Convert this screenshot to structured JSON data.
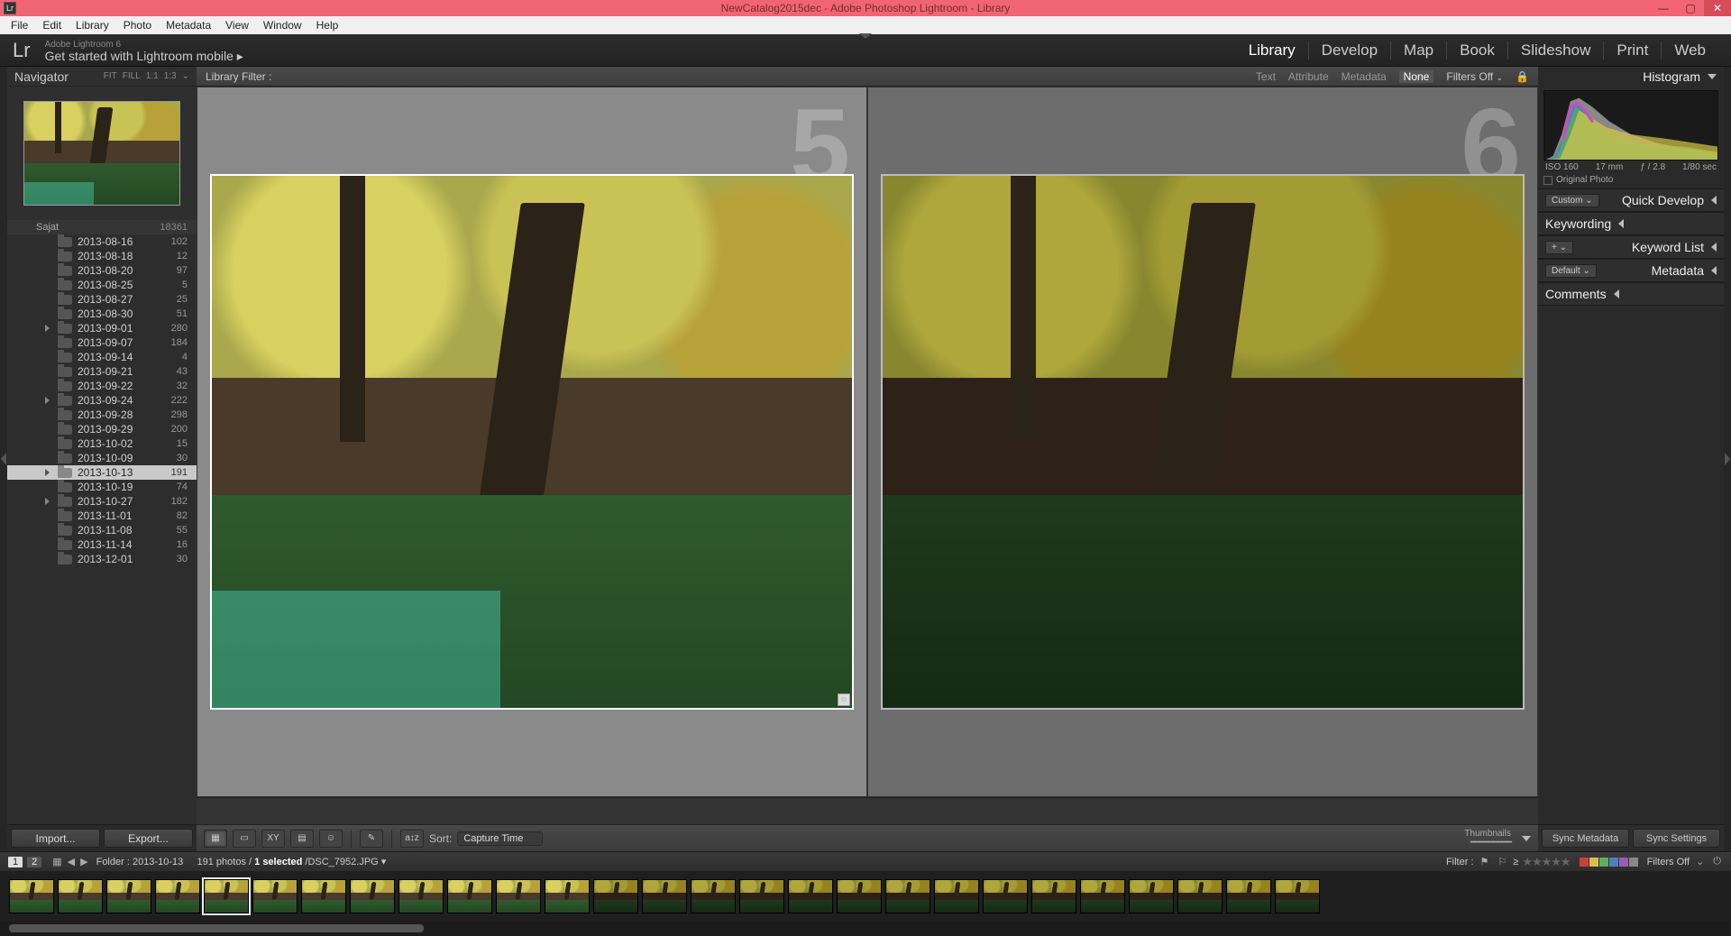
{
  "window": {
    "title": "NewCatalog2015dec - Adobe Photoshop Lightroom - Library",
    "min": "—",
    "max": "▢",
    "close": "✕"
  },
  "menu": [
    "File",
    "Edit",
    "Library",
    "Photo",
    "Metadata",
    "View",
    "Window",
    "Help"
  ],
  "header": {
    "logo": "Lr",
    "tag1": "Adobe Lightroom 6",
    "tag2": "Get started with Lightroom mobile  ▸",
    "modules": [
      "Library",
      "Develop",
      "Map",
      "Book",
      "Slideshow",
      "Print",
      "Web"
    ],
    "active_module": "Library"
  },
  "navigator": {
    "title": "Navigator",
    "opts": [
      "FIT",
      "FILL",
      "1:1",
      "1:3"
    ],
    "arrow": "⌄"
  },
  "folder_root": {
    "name": "Sajat",
    "count": "18361"
  },
  "folders": [
    {
      "name": "2013-08-16",
      "count": "102",
      "tri": false
    },
    {
      "name": "2013-08-18",
      "count": "12",
      "tri": false
    },
    {
      "name": "2013-08-20",
      "count": "97",
      "tri": false
    },
    {
      "name": "2013-08-25",
      "count": "5",
      "tri": false
    },
    {
      "name": "2013-08-27",
      "count": "25",
      "tri": false
    },
    {
      "name": "2013-08-30",
      "count": "51",
      "tri": false
    },
    {
      "name": "2013-09-01",
      "count": "280",
      "tri": true
    },
    {
      "name": "2013-09-07",
      "count": "184",
      "tri": false
    },
    {
      "name": "2013-09-14",
      "count": "4",
      "tri": false
    },
    {
      "name": "2013-09-21",
      "count": "43",
      "tri": false
    },
    {
      "name": "2013-09-22",
      "count": "32",
      "tri": false
    },
    {
      "name": "2013-09-24",
      "count": "222",
      "tri": true
    },
    {
      "name": "2013-09-28",
      "count": "298",
      "tri": false
    },
    {
      "name": "2013-09-29",
      "count": "200",
      "tri": false
    },
    {
      "name": "2013-10-02",
      "count": "15",
      "tri": false
    },
    {
      "name": "2013-10-09",
      "count": "30",
      "tri": false
    },
    {
      "name": "2013-10-13",
      "count": "191",
      "tri": true,
      "selected": true
    },
    {
      "name": "2013-10-19",
      "count": "74",
      "tri": false
    },
    {
      "name": "2013-10-27",
      "count": "182",
      "tri": true
    },
    {
      "name": "2013-11-01",
      "count": "82",
      "tri": false
    },
    {
      "name": "2013-11-08",
      "count": "55",
      "tri": false
    },
    {
      "name": "2013-11-14",
      "count": "16",
      "tri": false
    },
    {
      "name": "2013-12-01",
      "count": "30",
      "tri": false
    }
  ],
  "left_buttons": {
    "import": "Import...",
    "export": "Export..."
  },
  "library_filter": {
    "label": "Library Filter :",
    "tabs": [
      "Text",
      "Attribute",
      "Metadata",
      "None"
    ],
    "active": "None",
    "filters_off": "Filters Off",
    "lock": "🔒"
  },
  "grid": {
    "index_left": "5",
    "index_right": "6"
  },
  "toolbar": {
    "sort_label": "Sort:",
    "sort_value": "Capture Time",
    "thumbs": "Thumbnails"
  },
  "right": {
    "histogram": "Histogram",
    "iso": "ISO 160",
    "focal": "17 mm",
    "aperture": "ƒ / 2.8",
    "shutter": "1/80 sec",
    "original": "Original Photo",
    "sections": [
      {
        "ctrl": "Custom",
        "title": "Quick Develop"
      },
      {
        "ctrl": null,
        "title": "Keywording"
      },
      {
        "ctrl": "+",
        "title": "Keyword List"
      },
      {
        "ctrl": "Default",
        "title": "Metadata"
      },
      {
        "ctrl": null,
        "title": "Comments"
      }
    ],
    "sync_meta": "Sync Metadata",
    "sync_set": "Sync Settings"
  },
  "status": {
    "pages": [
      "1",
      "2"
    ],
    "folder_label": "Folder :",
    "folder": "2013-10-13",
    "count": "191 photos /",
    "selected": "1 selected",
    "file": "/DSC_7952.JPG",
    "arrow": "▾",
    "filter_label": "Filter :",
    "ge": "≥",
    "filters_off": "Filters Off"
  },
  "filmstrip_count": 27,
  "swatch_colors": [
    "#c94040",
    "#d8c04a",
    "#5ab060",
    "#4a80c0",
    "#9a5ac0",
    "#888888"
  ]
}
